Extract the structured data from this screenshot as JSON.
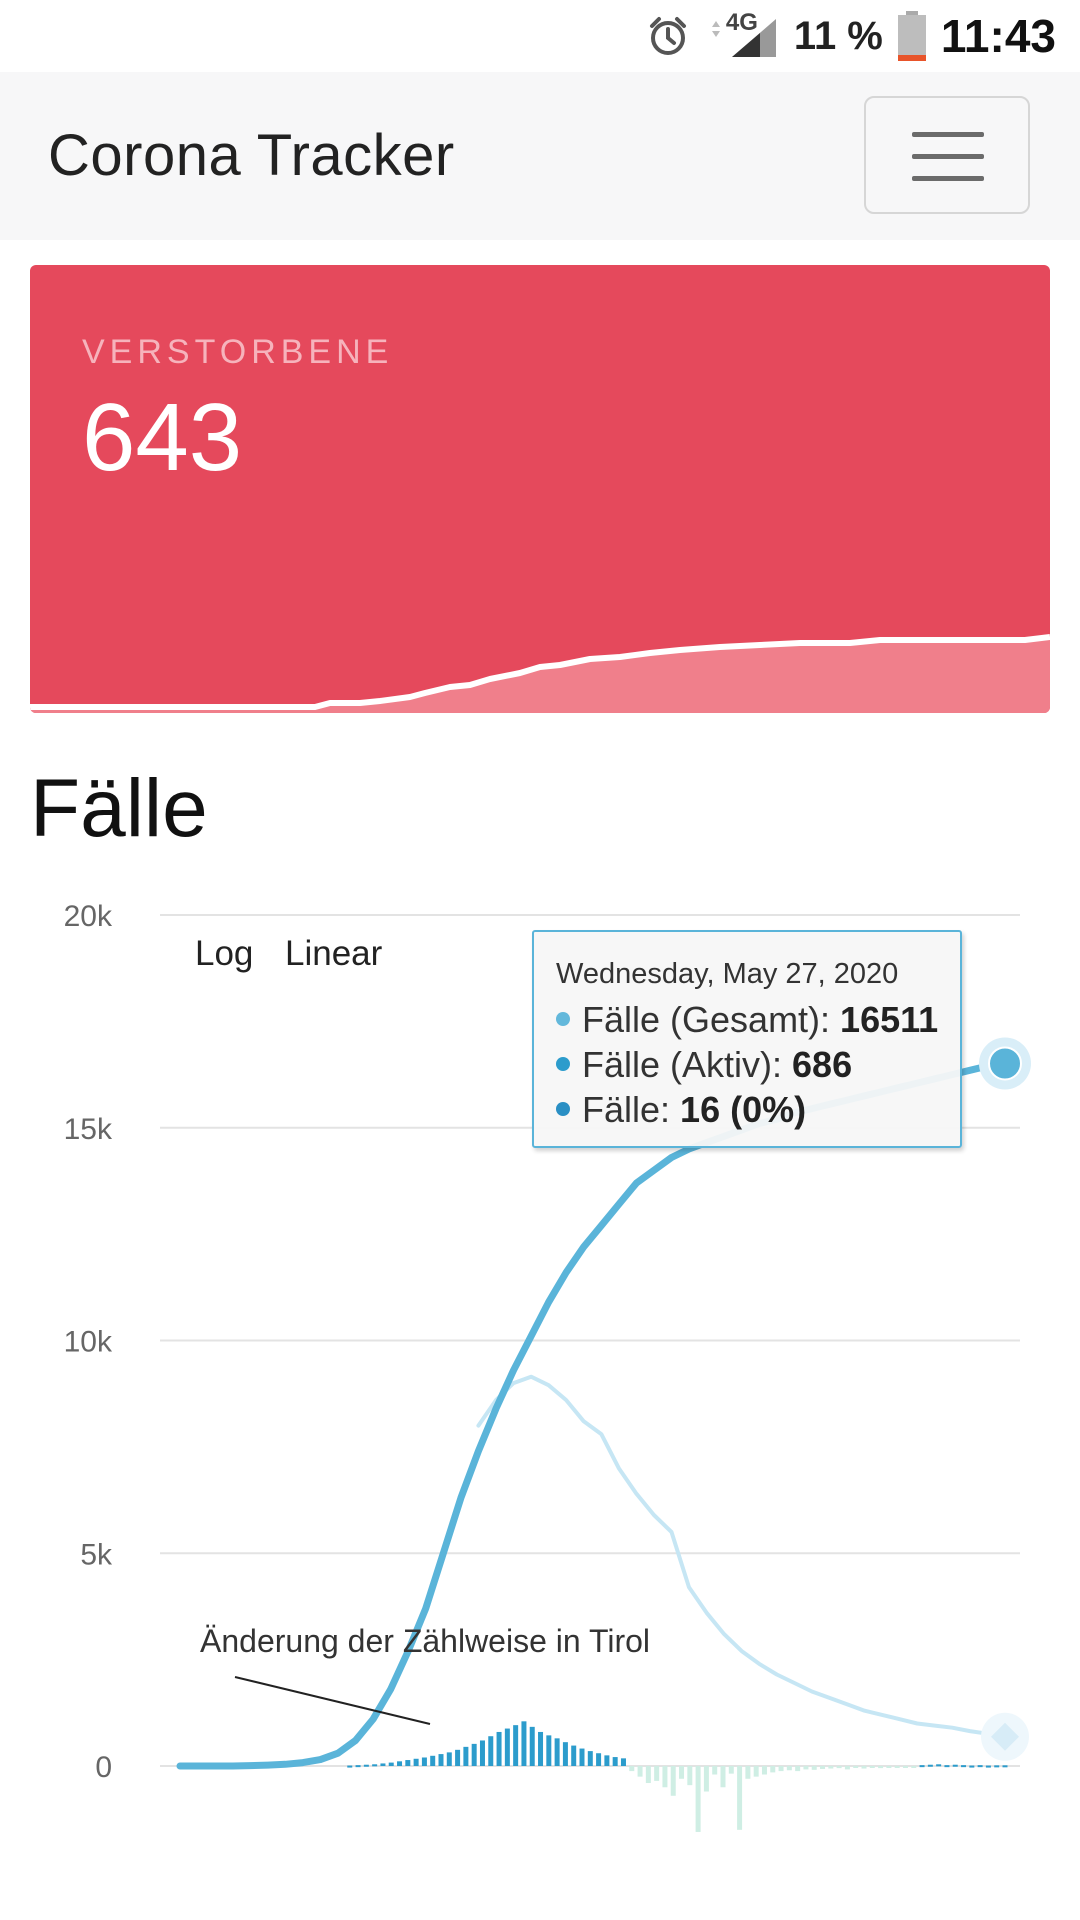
{
  "status_bar": {
    "network": "4G",
    "battery": "11 %",
    "time": "11:43",
    "icons": [
      "alarm-icon",
      "signal-icon",
      "battery-icon"
    ]
  },
  "navbar": {
    "brand": "Corona Tracker",
    "menu_icon": "hamburger-icon"
  },
  "deaths_card": {
    "label": "VERSTORBENE",
    "value": "643",
    "background": "#e5495c",
    "spark_fill": "#f07f8b",
    "spark_line": "#ffffff"
  },
  "cases_section": {
    "title": "Fälle",
    "scale_buttons": [
      "Log",
      "Linear"
    ],
    "annotation": "Änderung der Zählweise in Tirol",
    "tooltip": {
      "date": "Wednesday, May 27, 2020",
      "rows": [
        {
          "label": "Fälle (Gesamt): ",
          "value": "16511",
          "color": "#63b8db"
        },
        {
          "label": "Fälle (Aktiv): ",
          "value": "686",
          "color": "#2c9ccc"
        },
        {
          "label": "Fälle: ",
          "value": "16 (0%)",
          "color": "#2a8fc4"
        }
      ]
    }
  },
  "chart_data": {
    "type": "line",
    "y_ticks": [
      "20k",
      "15k",
      "10k",
      "5k",
      "0"
    ],
    "ylim": [
      0,
      20000
    ],
    "grid": true,
    "series": [
      {
        "name": "Fälle (Gesamt)",
        "color": "#5ab4d9",
        "values": [
          0,
          0,
          0,
          0,
          10,
          20,
          40,
          80,
          150,
          300,
          600,
          1100,
          1800,
          2700,
          3700,
          5000,
          6300,
          7400,
          8400,
          9300,
          10100,
          10900,
          11600,
          12200,
          12700,
          13200,
          13700,
          14000,
          14300,
          14500,
          14650,
          14800,
          14950,
          15100,
          15200,
          15350,
          15450,
          15550,
          15650,
          15750,
          15850,
          15950,
          16050,
          16150,
          16250,
          16350,
          16450,
          16511
        ]
      },
      {
        "name": "Fälle (Aktiv)",
        "color": "#c6e6f4",
        "values": [
          null,
          null,
          null,
          null,
          null,
          null,
          null,
          null,
          null,
          null,
          null,
          null,
          null,
          null,
          null,
          null,
          null,
          8000,
          8600,
          9000,
          9150,
          8950,
          8600,
          8100,
          7800,
          7000,
          6400,
          5900,
          5500,
          4200,
          3600,
          3100,
          2700,
          2400,
          2150,
          1950,
          1750,
          1600,
          1450,
          1300,
          1200,
          1100,
          1000,
          950,
          900,
          820,
          760,
          686
        ]
      },
      {
        "name": "Fälle",
        "type": "bar",
        "color": "#2c9ccc",
        "negative_color": "#cfeee4",
        "values": [
          0,
          0,
          0,
          0,
          0,
          0,
          10,
          20,
          30,
          40,
          60,
          80,
          110,
          140,
          170,
          200,
          240,
          280,
          320,
          380,
          450,
          520,
          600,
          700,
          800,
          880,
          960,
          1050,
          920,
          800,
          720,
          650,
          560,
          480,
          410,
          350,
          300,
          250,
          210,
          180,
          -120,
          -250,
          -400,
          -350,
          -500,
          -700,
          -300,
          -450,
          -1550,
          -600,
          -200,
          -500,
          -180,
          -1500,
          -300,
          -250,
          -200,
          -150,
          -120,
          -100,
          -120,
          -80,
          -90,
          -70,
          -60,
          -50,
          -80,
          -40,
          -60,
          -40,
          -50,
          -30,
          -40,
          -20,
          -30,
          20,
          30,
          40,
          20,
          30,
          20,
          10,
          20,
          10,
          15,
          16
        ]
      }
    ]
  }
}
